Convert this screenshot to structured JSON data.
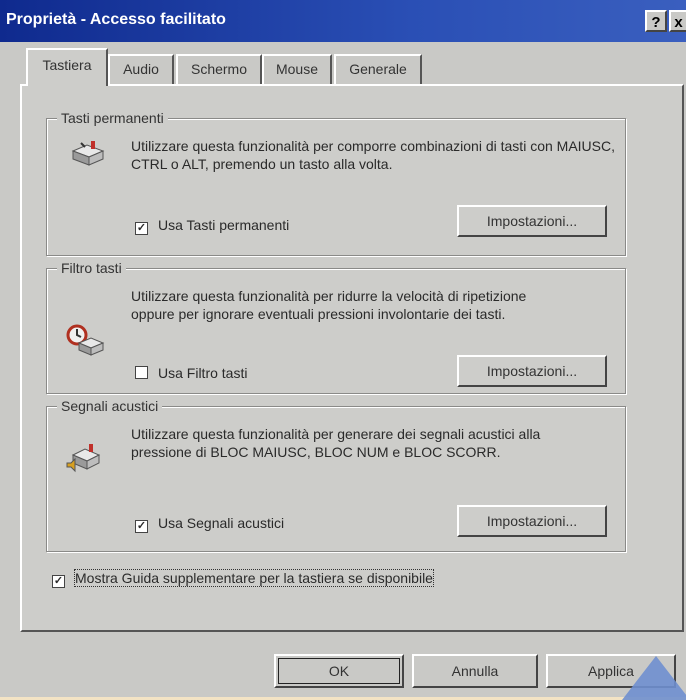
{
  "window": {
    "title": "Proprietà - Accesso facilitato",
    "help_button": "?",
    "close_button": "x"
  },
  "tabs": [
    {
      "label": "Tastiera",
      "active": true
    },
    {
      "label": "Audio",
      "active": false
    },
    {
      "label": "Schermo",
      "active": false
    },
    {
      "label": "Mouse",
      "active": false
    },
    {
      "label": "Generale",
      "active": false
    }
  ],
  "groups": {
    "sticky": {
      "label": "Tasti permanenti",
      "description": "Utilizzare questa funzionalità per comporre combinazioni di tasti con MAIUSC, CTRL o ALT, premendo un tasto alla volta.",
      "checkbox_label": "Usa Tasti permanenti",
      "checked": true,
      "settings_button": "Impostazioni..."
    },
    "filter": {
      "label": "Filtro tasti",
      "description": "Utilizzare questa funzionalità per ridurre la velocità di ripetizione oppure per ignorare eventuali pressioni involontarie dei tasti.",
      "checkbox_label": "Usa Filtro tasti",
      "checked": false,
      "settings_button": "Impostazioni..."
    },
    "toggle": {
      "label": "Segnali acustici",
      "description": "Utilizzare questa funzionalità per generare dei segnali acustici alla pressione di BLOC MAIUSC, BLOC NUM e BLOC SCORR.",
      "checkbox_label": "Usa Segnali acustici",
      "checked": true,
      "settings_button": "Impostazioni..."
    }
  },
  "extra_help": {
    "label": "Mostra Guida supplementare per la tastiera se disponibile",
    "checked": true
  },
  "footer": {
    "ok": "OK",
    "cancel": "Annulla",
    "apply": "Applica"
  },
  "colors": {
    "titlebar": "#0f2a8e",
    "face": "#c9c9c6",
    "background": "#f3e3c4"
  }
}
